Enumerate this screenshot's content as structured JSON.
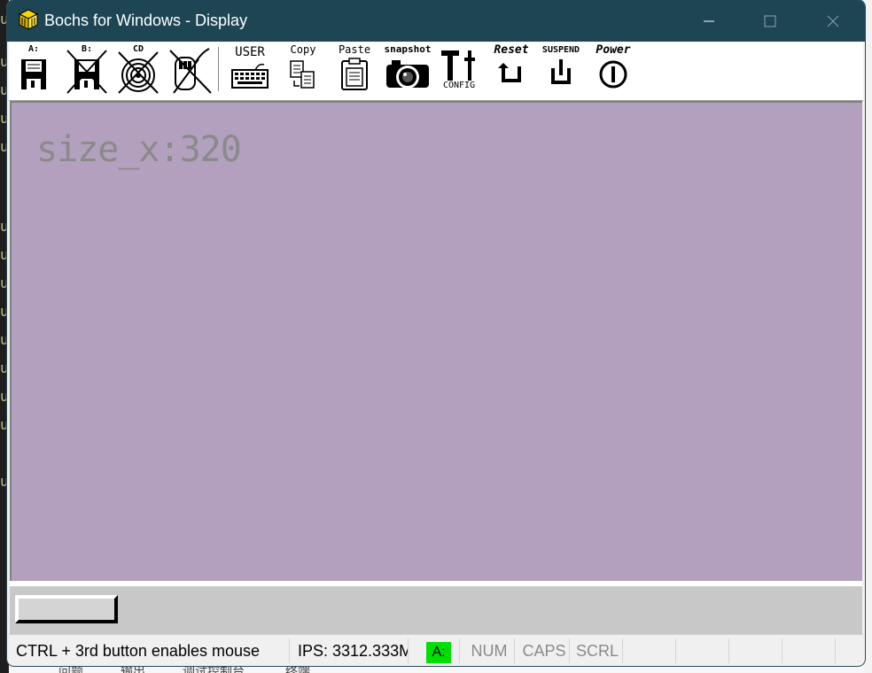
{
  "window": {
    "title": "Bochs for Windows - Display",
    "icon": "bochs-app-icon",
    "controls": [
      "minimize-icon",
      "maximize-icon",
      "close-icon"
    ]
  },
  "toolbar": {
    "floppy_a": "A:",
    "floppy_b": "B:",
    "cdrom": "CD",
    "mouse": "mouse",
    "user": "USER",
    "copy": "Copy",
    "paste": "Paste",
    "snapshot": "snapshot",
    "config": "CONFIG",
    "reset": "Reset",
    "suspend": "SUSPEND",
    "power": "Power"
  },
  "display": {
    "screen_text": "size_x:320",
    "background": "#b3a0be"
  },
  "statusbar": {
    "message": "CTRL + 3rd button enables mouse",
    "ips": "IPS: 3312.333M",
    "drive_led": "A:",
    "num": "NUM",
    "caps": "CAPS",
    "scrl": "SCRL"
  },
  "background_partial": {
    "editor_gutter_text": [
      "u",
      "u",
      "u",
      "u",
      "u",
      "u",
      "u",
      "u",
      "u",
      "u",
      "u",
      "u",
      "u",
      "u",
      "u"
    ],
    "bottom_tabs": [
      "问题",
      "输出",
      "调试控制台",
      "终端"
    ]
  }
}
